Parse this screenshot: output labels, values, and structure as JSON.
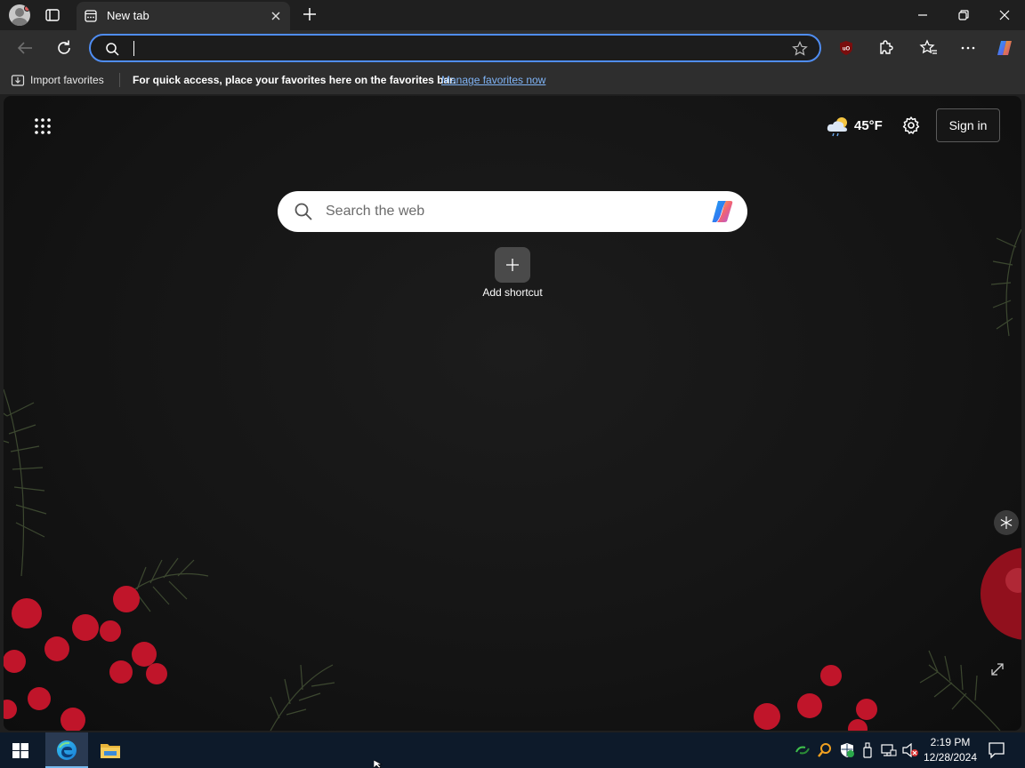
{
  "browser": {
    "tab": {
      "title": "New tab"
    },
    "address": {
      "value": "",
      "placeholder": ""
    },
    "favorites_bar": {
      "import_label": "Import favorites",
      "hint": "For quick access, place your favorites here on the favorites bar.",
      "manage_link": "Manage favorites now"
    }
  },
  "newtab": {
    "weather": {
      "temp": "45°F",
      "icon": "partly-cloudy-rain-icon"
    },
    "signin_label": "Sign in",
    "search_placeholder": "Search the web",
    "shortcut_label": "Add shortcut"
  },
  "taskbar": {
    "time": "2:19 PM",
    "date": "12/28/2024"
  },
  "colors": {
    "accent": "#4f8df3",
    "link": "#7fb3f5",
    "taskbar": "#0d1a2a",
    "berry": "#c0152a"
  }
}
